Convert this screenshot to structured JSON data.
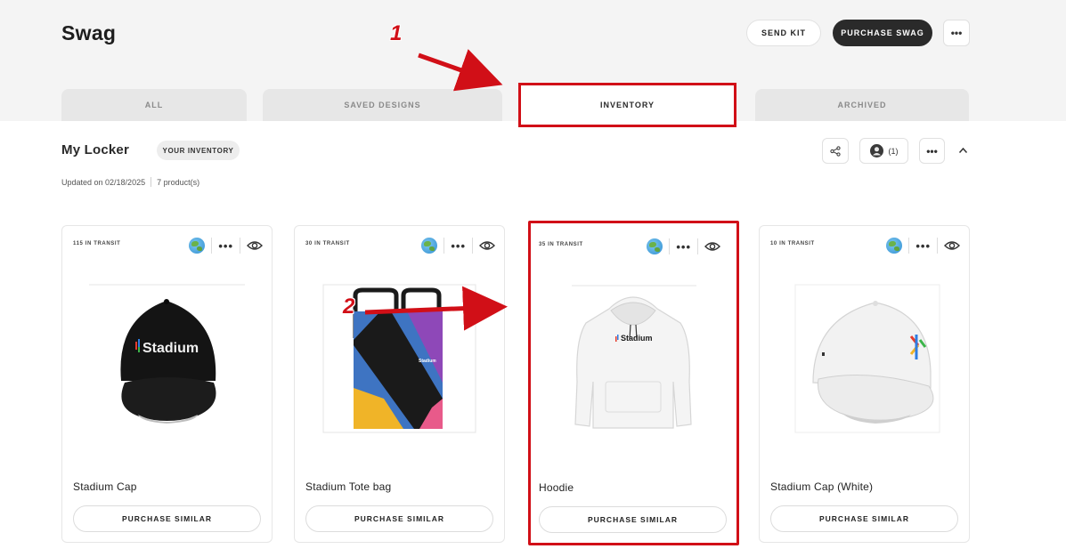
{
  "header": {
    "title": "Swag",
    "send_kit_label": "SEND KIT",
    "purchase_swag_label": "PURCHASE SWAG",
    "more_label": "•••"
  },
  "tabs": [
    {
      "label": "ALL"
    },
    {
      "label": "SAVED DESIGNS"
    },
    {
      "label": "INVENTORY",
      "active": true
    },
    {
      "label": "ARCHIVED"
    }
  ],
  "locker": {
    "title": "My Locker",
    "badge": "YOUR INVENTORY",
    "updated": "Updated on 02/18/2025",
    "product_count": "7 product(s)",
    "user_count": "(1)",
    "more_label": "•••"
  },
  "products": [
    {
      "transit": "115 IN TRANSIT",
      "name": "Stadium Cap",
      "button": "PURCHASE SIMILAR",
      "image": "black-cap"
    },
    {
      "transit": "30 IN TRANSIT",
      "name": "Stadium Tote bag",
      "button": "PURCHASE SIMILAR",
      "image": "tote-bag"
    },
    {
      "transit": "35 IN TRANSIT",
      "name": "Hoodie",
      "button": "PURCHASE SIMILAR",
      "image": "white-hoodie"
    },
    {
      "transit": "10 IN TRANSIT",
      "name": "Stadium Cap (White)",
      "button": "PURCHASE SIMILAR",
      "image": "white-cap"
    }
  ],
  "product_image_text": "Stadium",
  "card_more_label": "•••",
  "annotations": {
    "step1": "1",
    "step2": "2"
  },
  "colors": {
    "accent": "#d10f17",
    "dark_button": "#2a2a2a",
    "header_bg": "#f4f4f4"
  }
}
